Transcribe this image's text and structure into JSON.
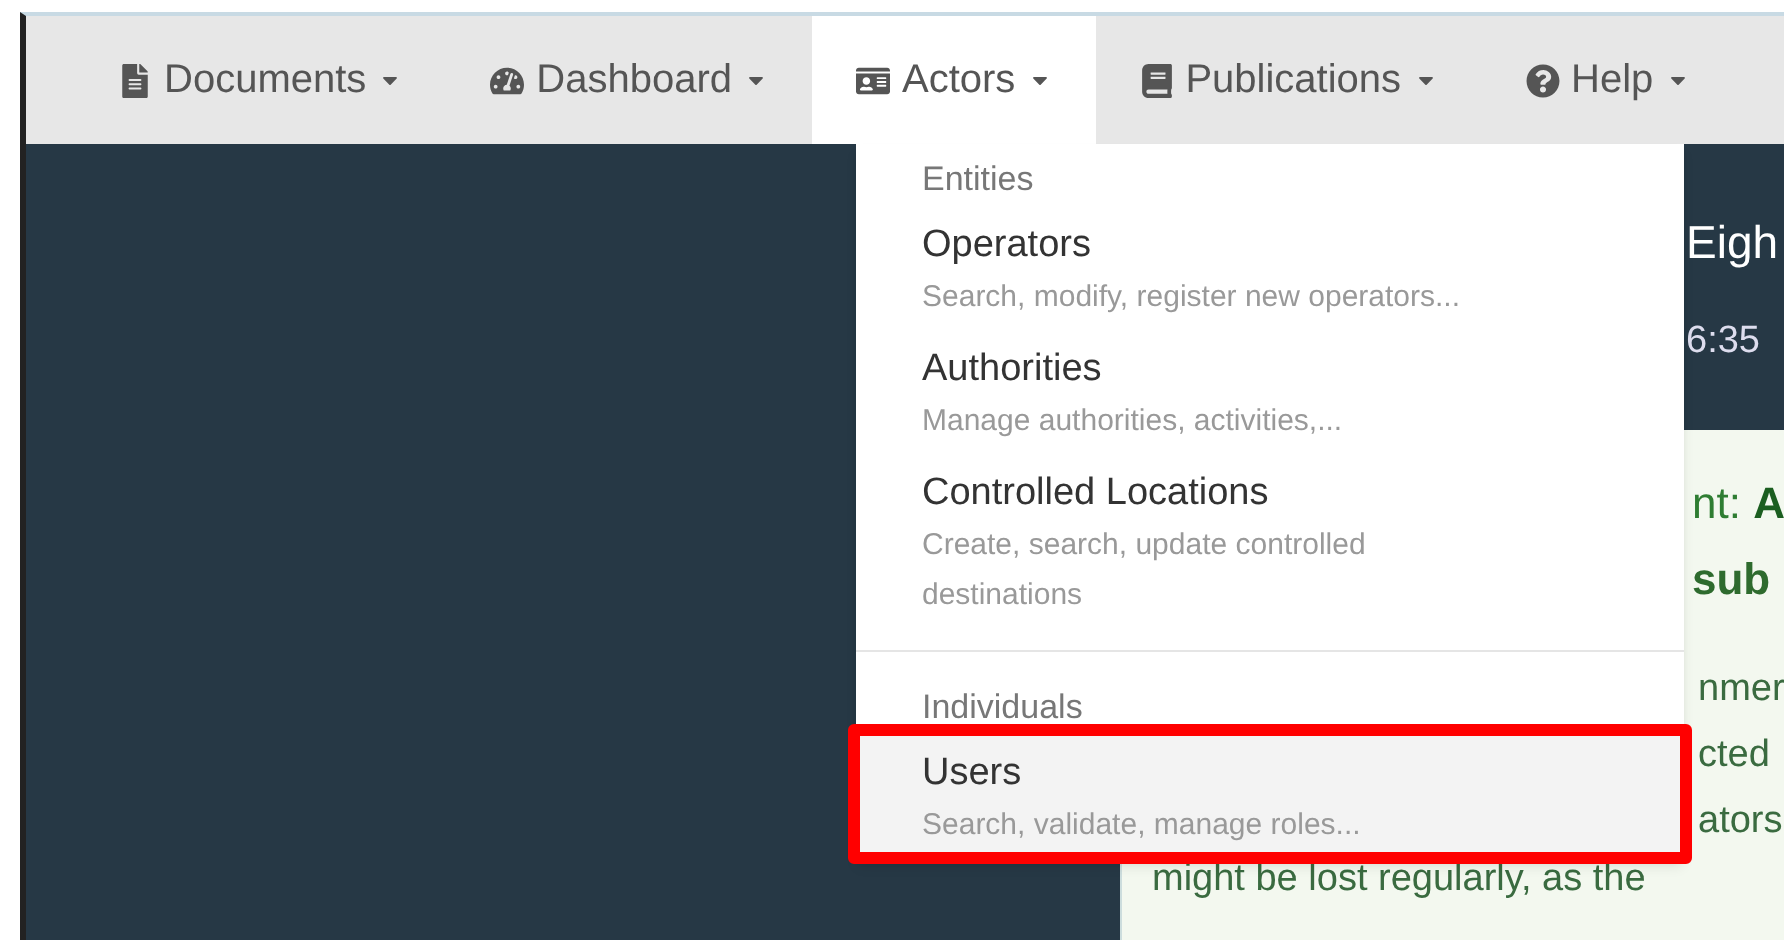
{
  "navbar": {
    "items": [
      {
        "label": "Documents",
        "selected": false
      },
      {
        "label": "Dashboard",
        "selected": false
      },
      {
        "label": "Actors",
        "selected": true
      },
      {
        "label": "Publications",
        "selected": false
      },
      {
        "label": "Help",
        "selected": false
      }
    ]
  },
  "dropdown": {
    "sections": [
      {
        "header": "Entities",
        "items": [
          {
            "title": "Operators",
            "description": "Search, modify, register new operators...",
            "highlighted": false,
            "annotated": false
          },
          {
            "title": "Authorities",
            "description": "Manage authorities, activities,...",
            "highlighted": false,
            "annotated": false
          },
          {
            "title": "Controlled Locations",
            "description": "Create, search, update controlled destinations",
            "highlighted": false,
            "annotated": false
          }
        ]
      },
      {
        "header": "Individuals",
        "items": [
          {
            "title": "Users",
            "description": "Search, validate, manage roles...",
            "highlighted": true,
            "annotated": true
          }
        ]
      }
    ]
  },
  "page_behind": {
    "title": "Eigh",
    "time": "6:35",
    "panel": {
      "heading_prefix": "nt: ",
      "heading_value": "A",
      "subheading": "sub",
      "lines": [
        "nmer",
        "cted",
        "ators"
      ],
      "last_line": "might be lost regularly, as the"
    }
  }
}
